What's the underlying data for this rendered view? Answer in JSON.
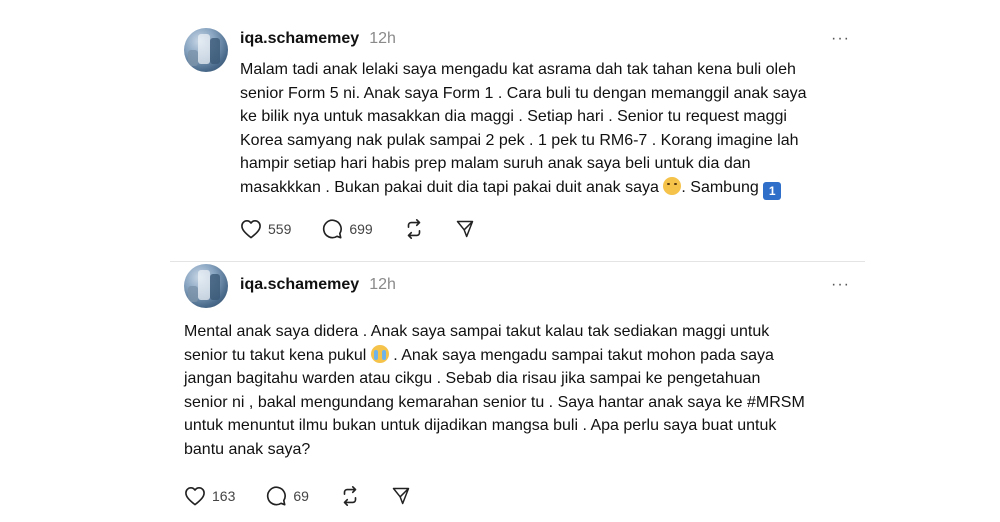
{
  "posts": [
    {
      "username": "iqa.schamemey",
      "time": "12h",
      "text_main": "Malam tadi anak lelaki saya mengadu kat asrama dah tak tahan kena buli oleh\nsenior Form 5 ni. Anak saya Form 1 . Cara buli tu dengan memanggil anak saya\nke bilik nya untuk masakkan dia maggi . Setiap hari . Senior tu request maggi\nKorea samyang nak pulak sampai 2 pek . 1 pek tu RM6-7 . Korang imagine lah\nhampir setiap hari habis prep malam suruh anak saya beli untuk dia dan\nmasakkkan . Bukan pakai duit dia tapi pakai duit anak saya ",
      "text_tail": ". Sambung ",
      "keycap": "1",
      "likes": "559",
      "comments": "699"
    },
    {
      "username": "iqa.schamemey",
      "time": "12h",
      "text_a": "Mental anak saya didera . Anak saya sampai takut kalau tak sediakan maggi untuk\nsenior tu takut kena pukul ",
      "text_b": " . Anak saya mengadu sampai takut mohon pada saya\njangan bagitahu warden atau cikgu . Sebab dia risau jika sampai ke pengetahuan\nsenior ni , bakal mengundang kemarahan senior tu . Saya hantar anak saya ke #MRSM\nuntuk menuntut ilmu bukan untuk dijadikan mangsa buli . Apa perlu saya buat untuk\nbantu anak saya?",
      "likes": "163",
      "comments": "69"
    }
  ],
  "more_label": "···"
}
